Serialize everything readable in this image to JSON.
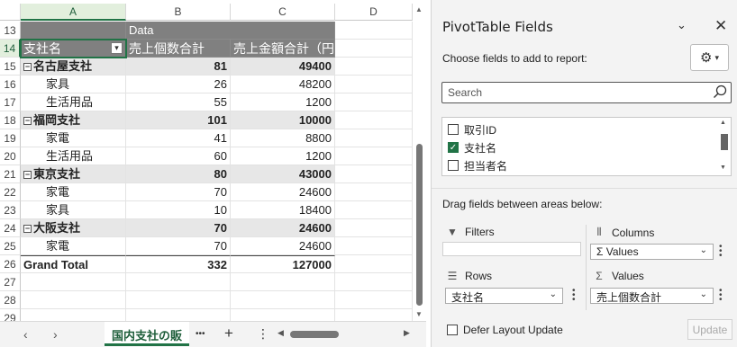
{
  "columns": [
    "A",
    "B",
    "C",
    "D"
  ],
  "rows_numbers": [
    "13",
    "14",
    "15",
    "16",
    "17",
    "18",
    "19",
    "20",
    "21",
    "22",
    "23",
    "24",
    "25",
    "26",
    "27",
    "28",
    "29"
  ],
  "pivot": {
    "data_label": "Data",
    "header_col_a": "支社名",
    "header_col_b": "売上個数合計",
    "header_col_c": "売上金額合計（円）",
    "rows": [
      {
        "name": "名古屋支社",
        "b": "81",
        "c": "49400"
      },
      {
        "name": "家具",
        "b": "26",
        "c": "48200"
      },
      {
        "name": "生活用品",
        "b": "55",
        "c": "1200"
      },
      {
        "name": "福岡支社",
        "b": "101",
        "c": "10000"
      },
      {
        "name": "家電",
        "b": "41",
        "c": "8800"
      },
      {
        "name": "生活用品",
        "b": "60",
        "c": "1200"
      },
      {
        "name": "東京支社",
        "b": "80",
        "c": "43000"
      },
      {
        "name": "家電",
        "b": "70",
        "c": "24600"
      },
      {
        "name": "家具",
        "b": "10",
        "c": "18400"
      },
      {
        "name": "大阪支社",
        "b": "70",
        "c": "24600"
      },
      {
        "name": "家電",
        "b": "70",
        "c": "24600"
      },
      {
        "name": "Grand Total",
        "b": "332",
        "c": "127000"
      }
    ],
    "collapse_symbol": "⊟"
  },
  "tabbar": {
    "sheet_tab": "国内支社の販",
    "more": "•••",
    "add": "+",
    "kebab": "⋮",
    "prev": "‹",
    "next": "›"
  },
  "pane": {
    "title": "PivotTable Fields",
    "choose_label": "Choose fields to add to report:",
    "search_placeholder": "Search",
    "fields": [
      {
        "label": "取引ID",
        "checked": false
      },
      {
        "label": "支社名",
        "checked": true
      },
      {
        "label": "担当者名",
        "checked": false
      }
    ],
    "drag_label": "Drag fields between areas below:",
    "filters_label": "Filters",
    "columns_label": "Columns",
    "columns_item": "Values",
    "rows_label": "Rows",
    "rows_item": "支社名",
    "values_label": "Values",
    "values_item": "売上個数合計",
    "defer_label": "Defer Layout Update",
    "update_label": "Update"
  },
  "colors": {
    "accent": "#217346",
    "pivot_header": "#808080",
    "subtotal_row": "#e7e7e7"
  }
}
